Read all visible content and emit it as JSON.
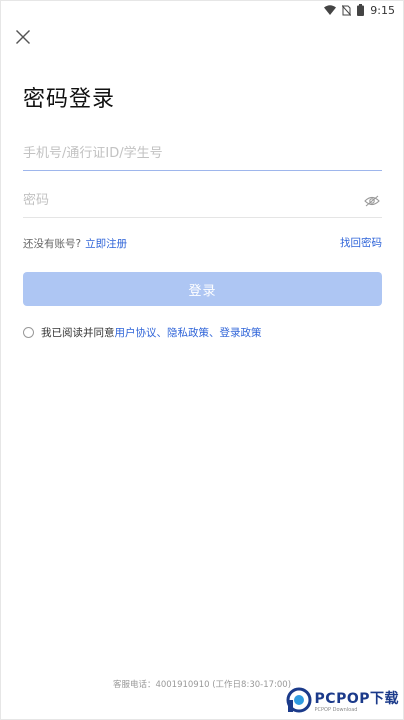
{
  "status_bar": {
    "time": "9:15",
    "icons": [
      "wifi-icon",
      "no-sim-icon",
      "battery-icon"
    ]
  },
  "header": {
    "close_icon": "close-icon"
  },
  "page": {
    "title": "密码登录"
  },
  "form": {
    "phone": {
      "value": "",
      "placeholder": "手机号/通行证ID/学生号"
    },
    "password": {
      "value": "",
      "placeholder": "密码",
      "toggle_icon": "eye-off-icon"
    },
    "no_account_text": "还没有账号?",
    "register_link": "立即注册",
    "forgot_link": "找回密码",
    "login_button": "登录"
  },
  "agreement": {
    "prefix": "我已阅读并同意",
    "links": "用户协议、隐私政策、登录政策"
  },
  "footer": {
    "hotline": "客服电话：4001910910 (工作日8:30-17:00)"
  },
  "watermark": {
    "brand": "PCPOP下载",
    "sub": "PCPOP Download"
  },
  "colors": {
    "accent": "#2f64d8",
    "button_disabled": "#aec6f3",
    "active_underline": "#9eb6ec",
    "watermark_brand": "#1b3a8a"
  }
}
